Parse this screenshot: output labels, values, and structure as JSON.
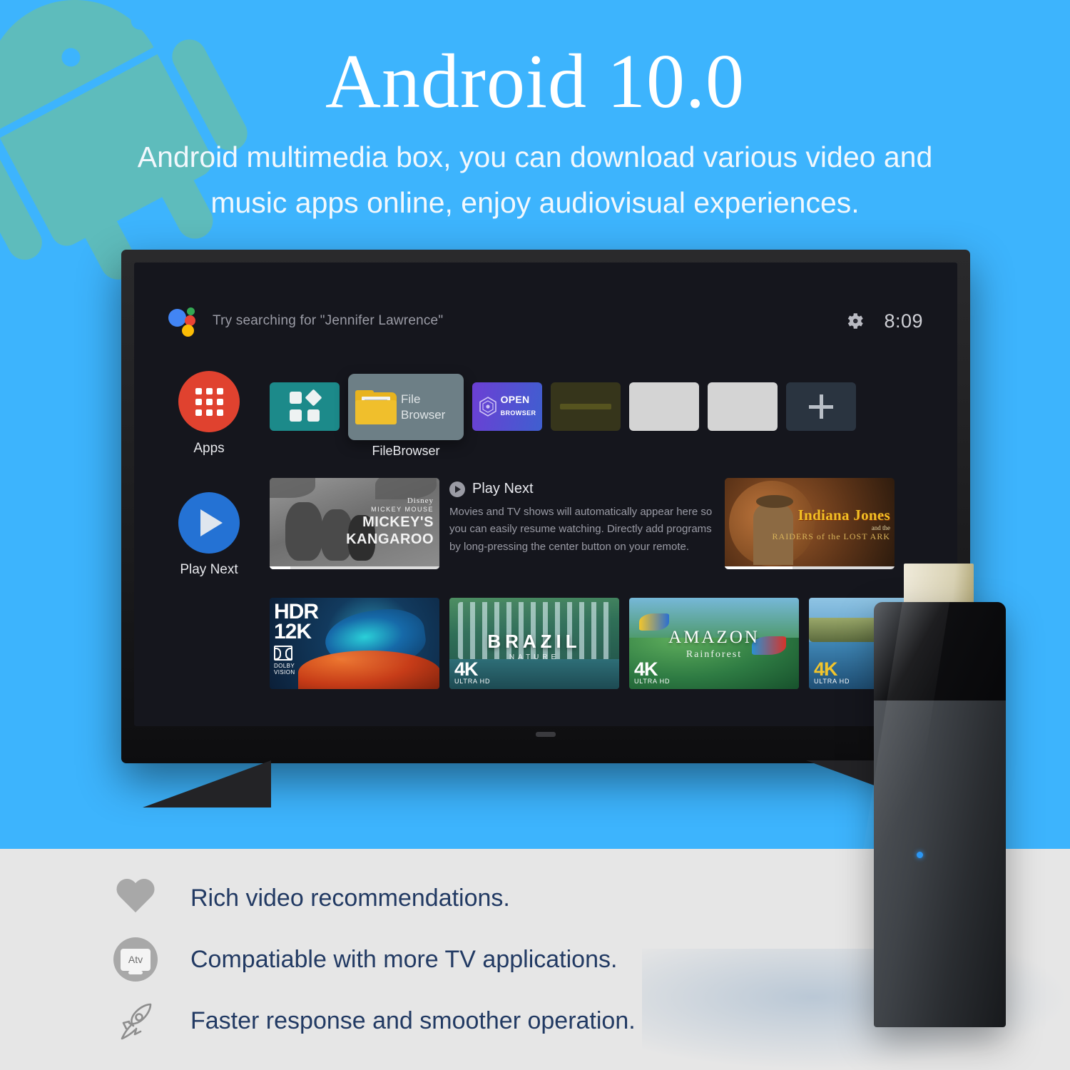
{
  "theme": {
    "background": "#3db4fd",
    "panel_background": "#e6e6e6",
    "feature_text_color": "#223a63",
    "apps_circle_color": "#e0422f",
    "play_circle_color": "#2472d4"
  },
  "header": {
    "title": "Android 10.0",
    "subtitle_line1": "Android multimedia box, you can download various video and",
    "subtitle_line2": "music apps online, enjoy audiovisual experiences."
  },
  "tv": {
    "topbar": {
      "assistant_icon": "google-assistant-icon",
      "search_hint": "Try searching for \"Jennifer Lawrence\"",
      "settings_icon": "gear-icon",
      "clock": "8:09"
    },
    "sidebar": [
      {
        "label": "Apps",
        "icon": "apps-grid-icon"
      },
      {
        "label": "Play Next",
        "icon": "play-icon"
      }
    ],
    "apps_row": {
      "focused_tile": {
        "line1": "File",
        "line2": "Browser",
        "caption": "FileBrowser",
        "icon": "folder-icon"
      },
      "tiles": [
        {
          "name": "shortcuts-tile",
          "label": ""
        },
        {
          "name": "open-browser-tile",
          "label_top": "OPEN",
          "label_bottom": "BROWSER",
          "icon": "hexagon-icon"
        },
        {
          "name": "olive-tile",
          "label": ""
        },
        {
          "name": "light-tile-1",
          "label": ""
        },
        {
          "name": "light-tile-2",
          "label": ""
        },
        {
          "name": "add-channel-tile",
          "label": "+"
        }
      ]
    },
    "play_next": {
      "title": "Play Next",
      "description": "Movies and TV shows will automatically appear here so you can easily resume watching. Directly add programs by long-pressing the center button on your remote.",
      "thumb_left": {
        "brand": "Disney",
        "series": "MICKEY MOUSE",
        "title_line1": "MICKEY'S",
        "title_line2": "KANGAROO"
      },
      "thumb_right": {
        "title": "Indiana Jones",
        "sub1": "and the",
        "sub2": "RAIDERS of the LOST ARK"
      }
    },
    "video_row": [
      {
        "name": "hdr-12k-card",
        "line1": "HDR",
        "line2": "12K",
        "badge": "DOLBY VISION",
        "badge_line1": "DOLBY",
        "badge_line2": "VISION"
      },
      {
        "name": "brazil-card",
        "title": "BRAZIL",
        "subtitle": "NATURE",
        "badge_big": "4K",
        "badge_small": "ULTRA HD"
      },
      {
        "name": "amazon-card",
        "title": "AMAZON",
        "subtitle": "Rainforest",
        "badge_big": "4K",
        "badge_small": "ULTRA HD"
      },
      {
        "name": "coast-card",
        "title": "",
        "subtitle": "",
        "badge_big": "4K",
        "badge_small": "ULTRA HD"
      }
    ]
  },
  "device": {
    "name": "android-tv-stick",
    "connector": "hdmi-connector",
    "led": "status-led"
  },
  "features": [
    {
      "icon": "heart-icon",
      "text": "Rich video recommendations."
    },
    {
      "icon": "atv-icon",
      "text": "Compatiable with more TV applications."
    },
    {
      "icon": "rocket-icon",
      "text": "Faster response and smoother operation."
    }
  ]
}
